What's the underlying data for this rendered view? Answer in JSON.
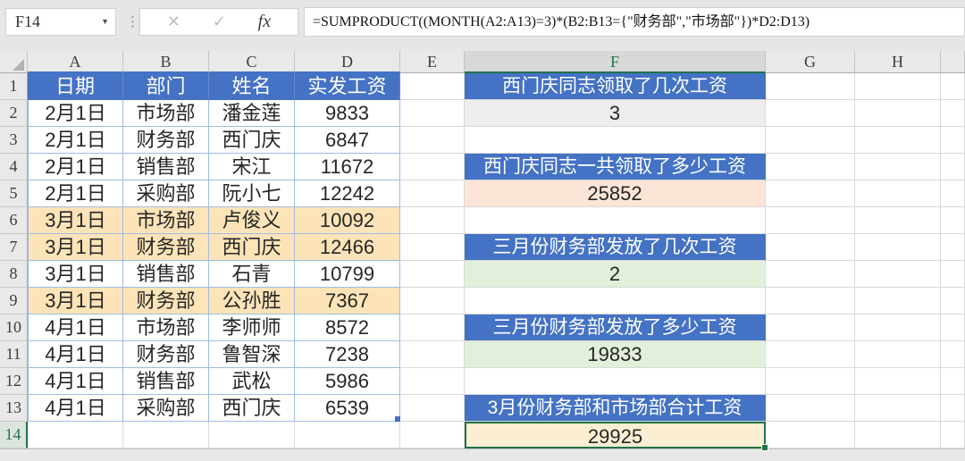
{
  "formula_bar": {
    "name_box": "F14",
    "formula": "=SUMPRODUCT((MONTH(A2:A13)=3)*(B2:B13={\"财务部\",\"市场部\"})*D2:D13)"
  },
  "icons": {
    "dropdown": "▼",
    "more": "⋮",
    "cancel": "✕",
    "confirm": "✓",
    "function": "fx"
  },
  "columns": [
    "A",
    "B",
    "C",
    "D",
    "E",
    "F",
    "G",
    "H"
  ],
  "row_numbers": [
    "1",
    "2",
    "3",
    "4",
    "5",
    "6",
    "7",
    "8",
    "9",
    "10",
    "11",
    "12",
    "13",
    "14"
  ],
  "selection": {
    "active_cell": "F14",
    "active_column": "F",
    "active_row": "14",
    "reference_columns": [
      "A",
      "B",
      "C",
      "D"
    ]
  },
  "table": {
    "headers": [
      "日期",
      "部门",
      "姓名",
      "实发工资"
    ],
    "rows": [
      {
        "date": "2月1日",
        "dept": "市场部",
        "name": "潘金莲",
        "salary": "9833",
        "highlight": false
      },
      {
        "date": "2月1日",
        "dept": "财务部",
        "name": "西门庆",
        "salary": "6847",
        "highlight": false
      },
      {
        "date": "2月1日",
        "dept": "销售部",
        "name": "宋江",
        "salary": "11672",
        "highlight": false
      },
      {
        "date": "2月1日",
        "dept": "采购部",
        "name": "阮小七",
        "salary": "12242",
        "highlight": false
      },
      {
        "date": "3月1日",
        "dept": "市场部",
        "name": "卢俊义",
        "salary": "10092",
        "highlight": true
      },
      {
        "date": "3月1日",
        "dept": "财务部",
        "name": "西门庆",
        "salary": "12466",
        "highlight": true
      },
      {
        "date": "3月1日",
        "dept": "销售部",
        "name": "石青",
        "salary": "10799",
        "highlight": false
      },
      {
        "date": "3月1日",
        "dept": "财务部",
        "name": "公孙胜",
        "salary": "7367",
        "highlight": true
      },
      {
        "date": "4月1日",
        "dept": "市场部",
        "name": "李师师",
        "salary": "8572",
        "highlight": false
      },
      {
        "date": "4月1日",
        "dept": "财务部",
        "name": "鲁智深",
        "salary": "7238",
        "highlight": false
      },
      {
        "date": "4月1日",
        "dept": "销售部",
        "name": "武松",
        "salary": "5986",
        "highlight": false
      },
      {
        "date": "4月1日",
        "dept": "采购部",
        "name": "西门庆",
        "salary": "6539",
        "highlight": false
      }
    ]
  },
  "qa": [
    {
      "row": 1,
      "type": "question",
      "text": "西门庆同志领取了几次工资"
    },
    {
      "row": 2,
      "type": "answer",
      "text": "3",
      "fill": "gray"
    },
    {
      "row": 4,
      "type": "question",
      "text": "西门庆同志一共领取了多少工资"
    },
    {
      "row": 5,
      "type": "answer",
      "text": "25852",
      "fill": "pink"
    },
    {
      "row": 7,
      "type": "question",
      "text": "三月份财务部发放了几次工资"
    },
    {
      "row": 8,
      "type": "answer",
      "text": "2",
      "fill": "green"
    },
    {
      "row": 10,
      "type": "question",
      "text": "三月份财务部发放了多少工资"
    },
    {
      "row": 11,
      "type": "answer",
      "text": "19833",
      "fill": "green"
    },
    {
      "row": 13,
      "type": "question",
      "text": "3月份财务部和市场部合计工资"
    },
    {
      "row": 14,
      "type": "answer",
      "text": "29925",
      "fill": "selected"
    }
  ],
  "colors": {
    "accent_blue": "#4472C4",
    "selection_green": "#217346",
    "table_border_blue": "#9FBCE4",
    "row_highlight_tan": "#FCE4B8",
    "answer_gray": "#EDEDED",
    "answer_pink": "#FCE4D6",
    "answer_green": "#E2EFDA",
    "answer_cream": "#FBEED3",
    "gridline": "#D9D9D9"
  }
}
